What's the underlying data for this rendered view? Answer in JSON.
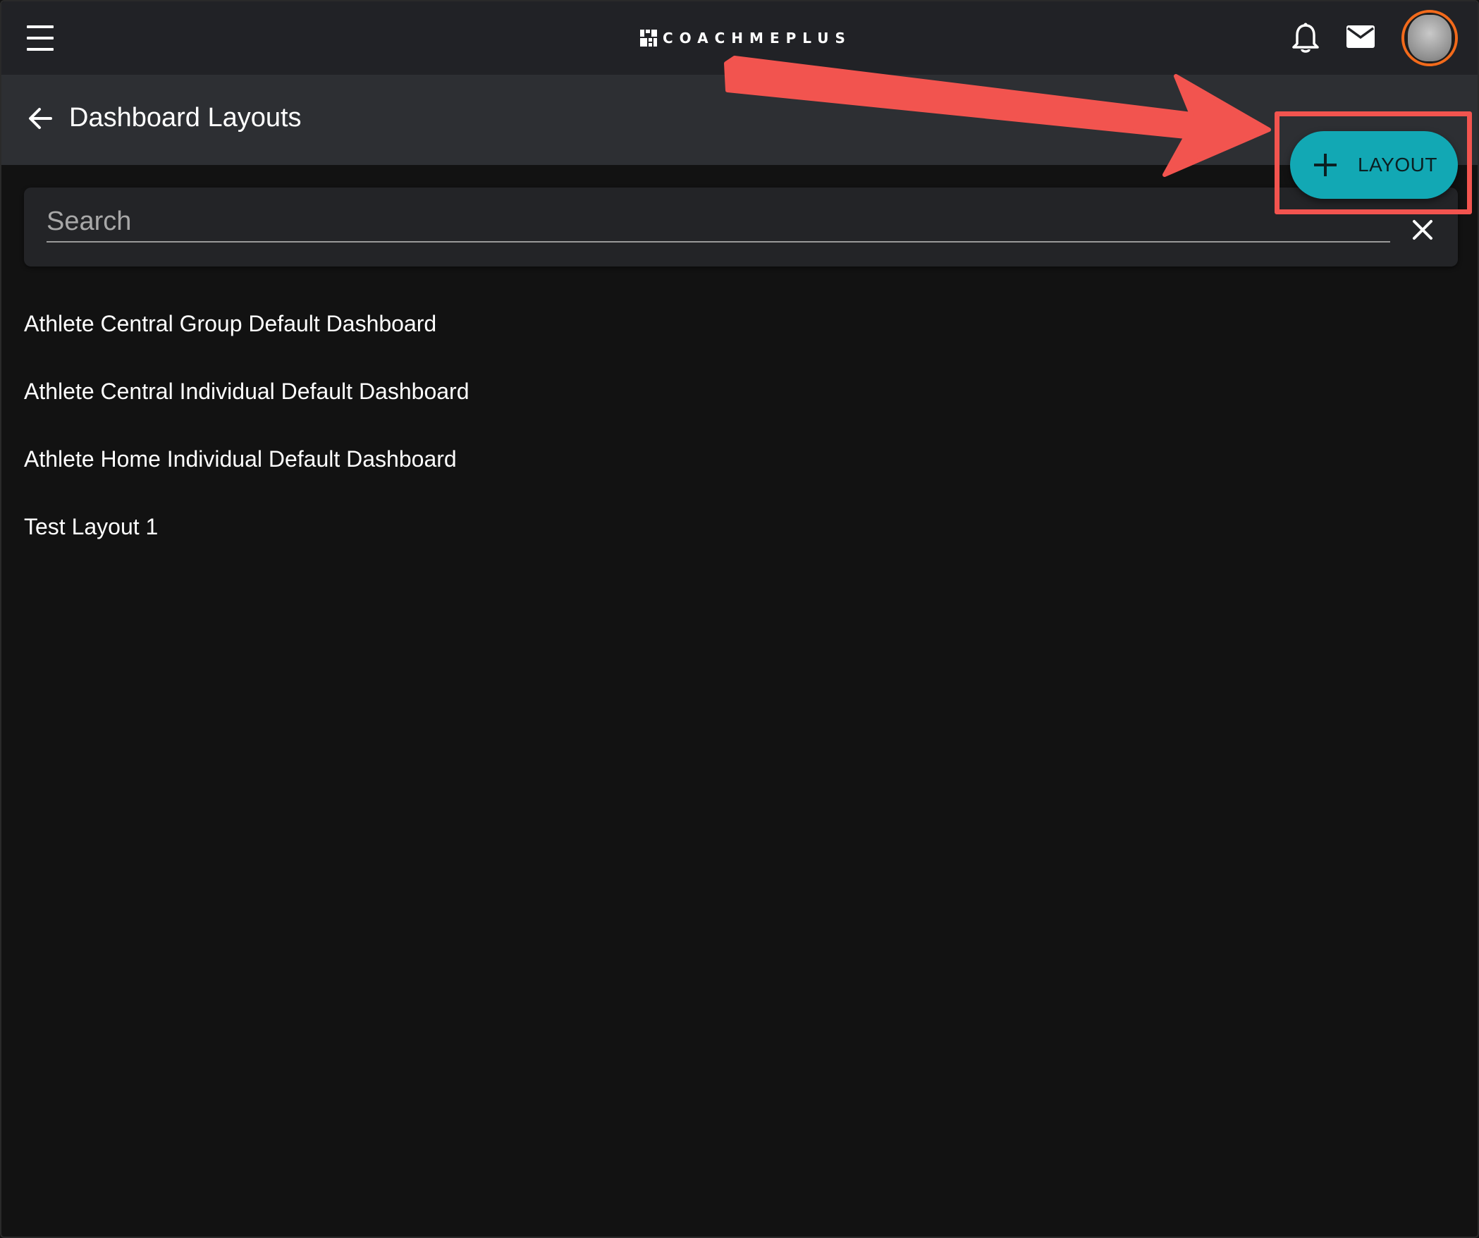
{
  "app": {
    "brand_name": "COACHMEPLUS"
  },
  "header": {
    "page_title": "Dashboard Layouts",
    "add_button_label": "LAYOUT"
  },
  "search": {
    "placeholder": "Search",
    "value": ""
  },
  "layouts": {
    "items": [
      {
        "label": "Athlete Central Group Default Dashboard"
      },
      {
        "label": "Athlete Central Individual Default Dashboard"
      },
      {
        "label": "Athlete Home Individual Default Dashboard"
      },
      {
        "label": "Test Layout 1"
      }
    ]
  },
  "icons": {
    "menu": "menu-icon",
    "notifications": "bell-icon",
    "messages": "mail-icon",
    "back": "arrow-left-icon",
    "clear": "close-icon",
    "add": "plus-icon"
  },
  "colors": {
    "accent": "#12a8b4",
    "avatar_ring": "#f26a1b",
    "annotation": "#f2544f",
    "appbar": "#212226",
    "subbar": "#2d2f33",
    "background": "#121212"
  }
}
